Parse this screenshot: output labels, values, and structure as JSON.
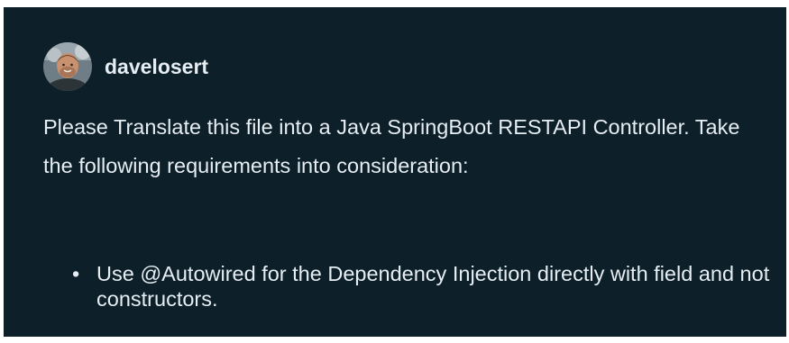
{
  "post": {
    "author": {
      "username": "davelosert",
      "avatar_icon": "user-avatar-photo"
    },
    "body": "Please Translate this file into a Java SpringBoot RESTAPI Controller. Take the following requirements into consideration:",
    "requirements": [
      "Use @Autowired for the Dependency Injection directly with field and not constructors."
    ]
  },
  "colors": {
    "background": "#0d2029",
    "text": "#e6edf3"
  }
}
